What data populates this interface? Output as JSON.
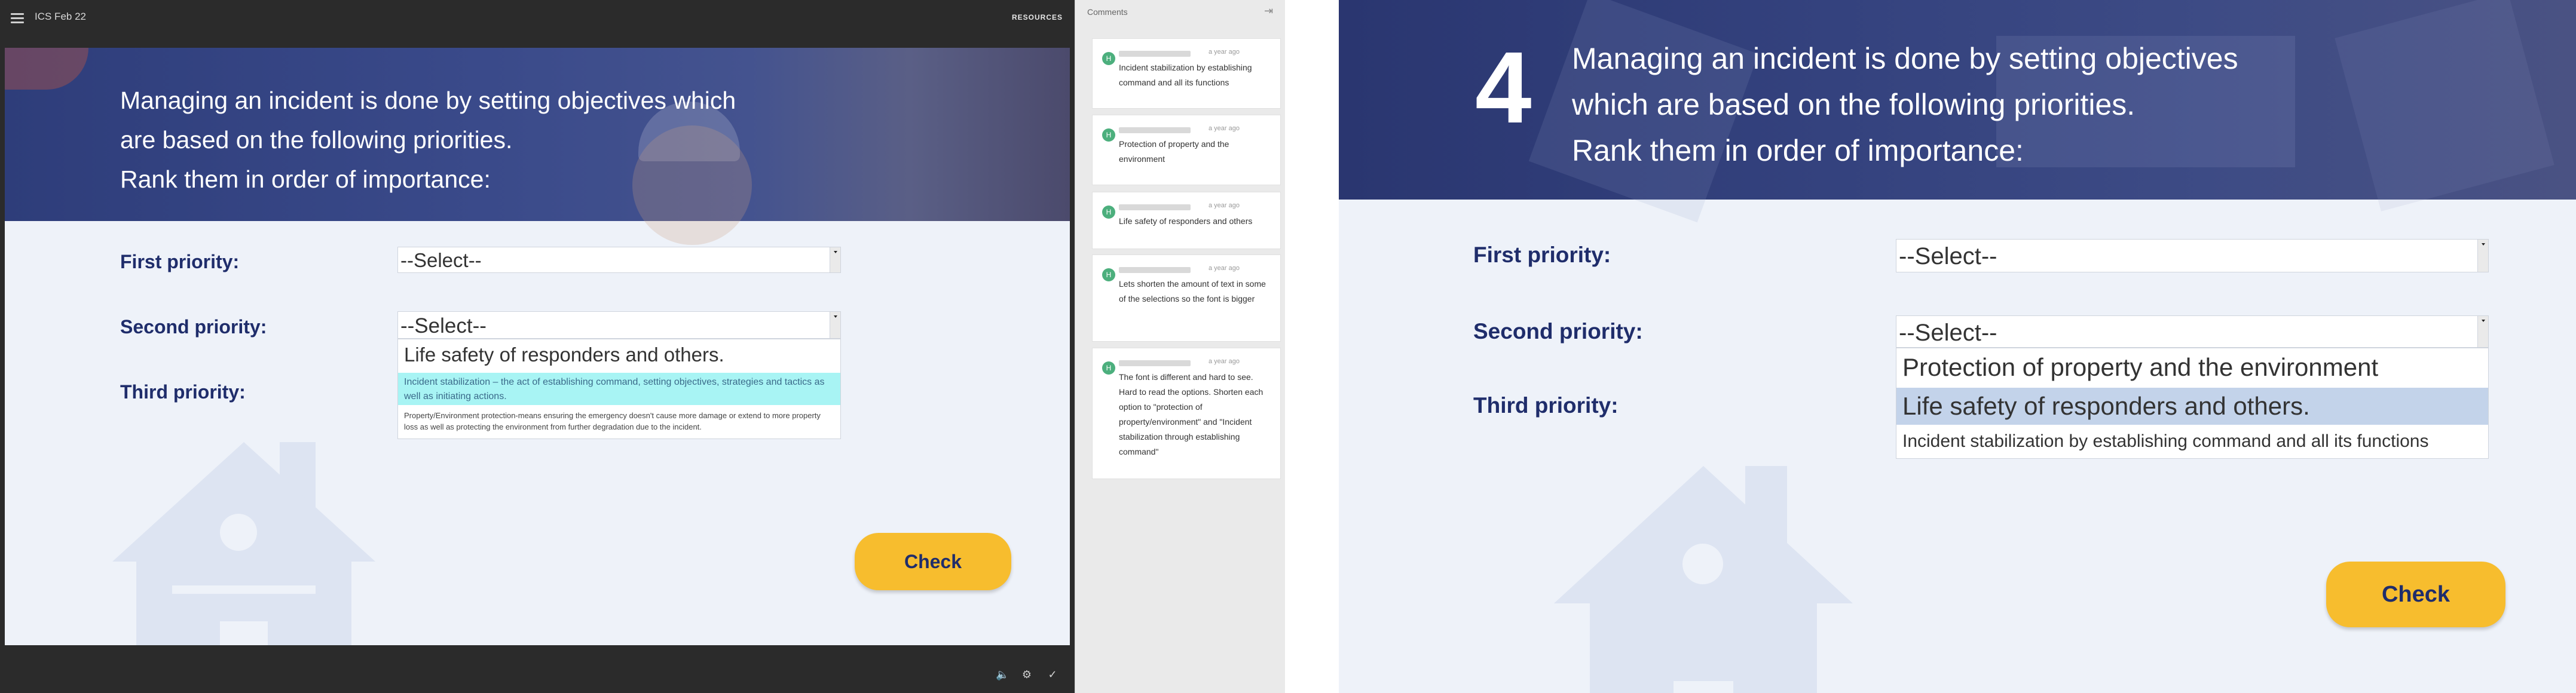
{
  "player": {
    "course_title": "ICS Feb 22",
    "resources_label": "RESOURCES"
  },
  "slide": {
    "question": "Managing an incident is done by setting objectives which\nare based on the following priorities.\nRank them in order of importance:",
    "priorities": {
      "first_label": "First priority:",
      "second_label": "Second priority:",
      "third_label": "Third priority:"
    },
    "select_placeholder": "--Select--",
    "dropdown_options": [
      "Life safety of responders and others.",
      "Incident stabilization – the act of establishing command, setting objectives, strategies and tactics as well as initiating actions.",
      "Property/Environment protection-means ensuring the emergency doesn't cause more damage or extend to more property loss as well as protecting the environment from further degradation due to the incident."
    ],
    "check_label": "Check"
  },
  "comments": {
    "title": "Comments",
    "items": [
      {
        "avatar": "H",
        "time": "a year ago",
        "text": "Incident stabilization by establishing command and all its functions"
      },
      {
        "avatar": "H",
        "time": "a year ago",
        "text": "Protection of property and the environment"
      },
      {
        "avatar": "H",
        "time": "a year ago",
        "text": "Life safety of responders and others"
      },
      {
        "avatar": "H",
        "time": "a year ago",
        "text": "Lets shorten the amount of text in some of the selections so the font is bigger"
      },
      {
        "avatar": "H",
        "time": "a year ago",
        "text": "The font is different and hard to see. Hard to read the options. Shorten each option to \"protection of property/environment\" and \"Incident stabilization through establishing command\""
      }
    ]
  },
  "slide2": {
    "step_number": "4",
    "question": "Managing an incident is done by setting objectives\nwhich are based on the following priorities.\nRank them in order of importance:",
    "priorities": {
      "first_label": "First priority:",
      "second_label": "Second priority:",
      "third_label": "Third priority:"
    },
    "select_placeholder": "--Select--",
    "dropdown_options": [
      "Protection of property and the environment",
      "Life safety of responders and others.",
      "Incident stabilization by establishing command and all its functions"
    ],
    "check_label": "Check"
  },
  "colors": {
    "header_blue": "#2e3d7a",
    "label_navy": "#1f2d6b",
    "check_yellow": "#f7bd2e",
    "highlight_cyan": "#a8f4f4",
    "highlight_blue": "#c3d3ea",
    "avatar_green": "#4caf7d"
  },
  "icons": {
    "menu": "hamburger-icon",
    "volume": "volume-icon",
    "settings": "gear-icon",
    "done": "checkmark-icon",
    "exit": "exit-icon",
    "house": "house-icon"
  }
}
